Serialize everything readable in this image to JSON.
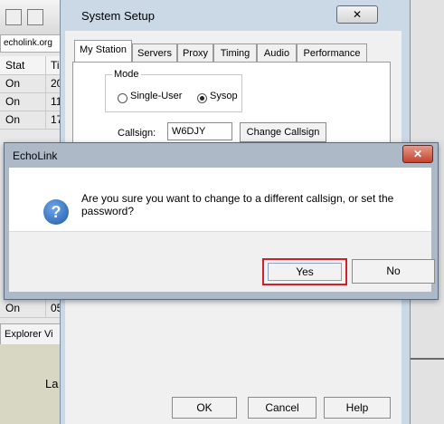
{
  "background_window": {
    "address_text": "echolink.org",
    "table": {
      "header": [
        "Stat",
        "Ti"
      ],
      "rows": [
        [
          "On",
          "20"
        ],
        [
          "On",
          "11"
        ],
        [
          "On",
          "17"
        ]
      ],
      "lower_row": [
        "On",
        "05"
      ]
    },
    "explorer_label": "Explorer Vi",
    "lower_pane_text": "La"
  },
  "system_setup": {
    "title": "System Setup",
    "close_glyph": "✕",
    "tabs": [
      "My Station",
      "Servers",
      "Proxy",
      "Timing",
      "Audio",
      "Performance"
    ],
    "active_tab": "My Station",
    "mode": {
      "label": "Mode",
      "options": [
        "Single-User",
        "Sysop"
      ],
      "selected": "Sysop"
    },
    "callsign_label": "Callsign:",
    "callsign_value": "W6DJY",
    "change_callsign_label": "Change Callsign",
    "buttons": {
      "ok": "OK",
      "cancel": "Cancel",
      "help": "Help"
    }
  },
  "dialog": {
    "title": "EchoLink",
    "close_glyph": "✕",
    "icon": "question-icon",
    "message": "Are you sure you want to change to a different callsign, or set the password?",
    "yes_label": "Yes",
    "no_label": "No",
    "highlight_color": "#d21f2b"
  }
}
